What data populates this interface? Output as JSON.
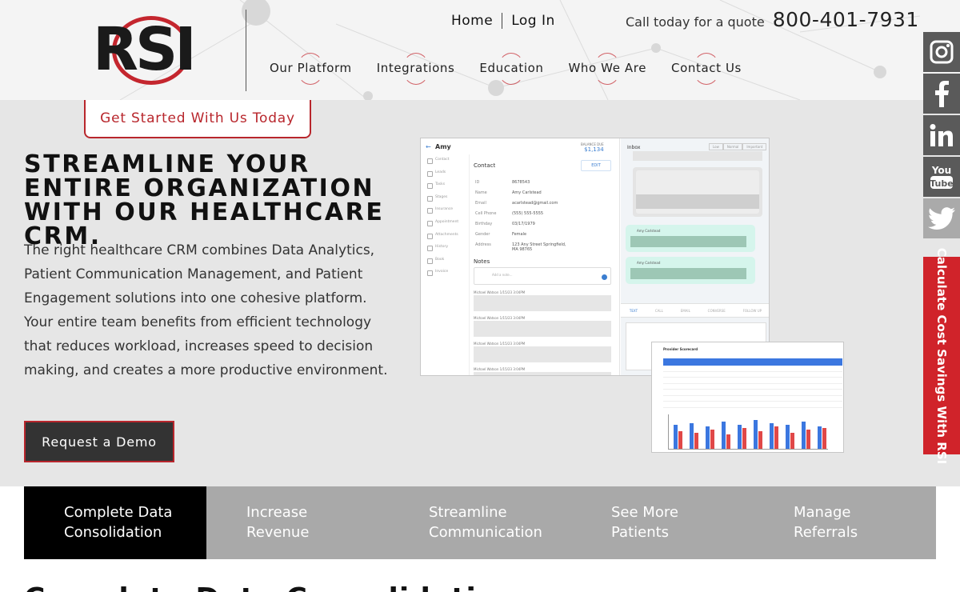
{
  "brand": {
    "logo_text": "RSI",
    "accent": "#c4262e"
  },
  "top_links": {
    "home": "Home",
    "login": "Log In"
  },
  "quote": {
    "label": "Call today for a quote",
    "phone": "800-401-7931"
  },
  "nav": [
    "Our Platform",
    "Integrations",
    "Education",
    "Who We Are",
    "Contact Us"
  ],
  "hero": {
    "cta_tab": "Get Started With Us Today",
    "title": "Streamline your entire organization with our healthcare CRM.",
    "body": "The right healthcare CRM combines Data Analytics, Patient Communication Management, and Patient Engagement solutions into one cohesive platform. Your entire team benefits from efficient technology that reduces workload, increases speed to decision making, and creates a more productive environment.",
    "demo_button": "Request a Demo"
  },
  "crm_mock": {
    "patient_name": "Amy",
    "balance_label": "BALANCE DUE",
    "balance": "$1,134",
    "sidebar": [
      "Contact",
      "Leads",
      "Tasks",
      "Stages",
      "Insurance",
      "Appointment",
      "Attachments",
      "History",
      "Book",
      "Invoice"
    ],
    "contact_title": "Contact",
    "edit": "EDIT",
    "fields": [
      {
        "label": "ID",
        "value": "8678543"
      },
      {
        "label": "Name",
        "value": "Amy Carlstead"
      },
      {
        "label": "Email",
        "value": "acarlstead@gmail.com"
      },
      {
        "label": "Cell Phone",
        "value": "(555) 555-5555"
      },
      {
        "label": "Birthday",
        "value": "03/17/1979"
      },
      {
        "label": "Gender",
        "value": "Female"
      },
      {
        "label": "Address",
        "value": "123 Any Street Springfield, MA 98765"
      }
    ],
    "notes_title": "Notes",
    "note_placeholder": "Add a note...",
    "note_headers": [
      "Michael Watson  1/15/23 3:04PM",
      "Michael Watson  1/15/23 3:04PM",
      "Michael Watson  1/15/23 3:04PM",
      "Michael Watson  1/15/23 3:04PM"
    ],
    "inbox_title": "Inbox",
    "priority": [
      "Low",
      "Normal",
      "Important"
    ],
    "message_sender": "Amy Carlstead",
    "tabs": [
      "TEXT",
      "CALL",
      "EMAIL",
      "CONVERSE",
      "FOLLOW UP"
    ]
  },
  "report_mock": {
    "title": "Provider Scorecard"
  },
  "social": [
    "instagram-icon",
    "facebook-icon",
    "linkedin-icon",
    "youtube-icon",
    "twitter-icon"
  ],
  "calc_tab": "Calculate Cost Savings With RSI",
  "feature_tabs": [
    {
      "line1": "Complete Data",
      "line2": "Consolidation"
    },
    {
      "line1": "Increase",
      "line2": "Revenue"
    },
    {
      "line1": "Streamline",
      "line2": "Communication"
    },
    {
      "line1": "See More",
      "line2": "Patients"
    },
    {
      "line1": "Manage",
      "line2": "Referrals"
    }
  ],
  "section_heading": "Complete Data Consolidation"
}
